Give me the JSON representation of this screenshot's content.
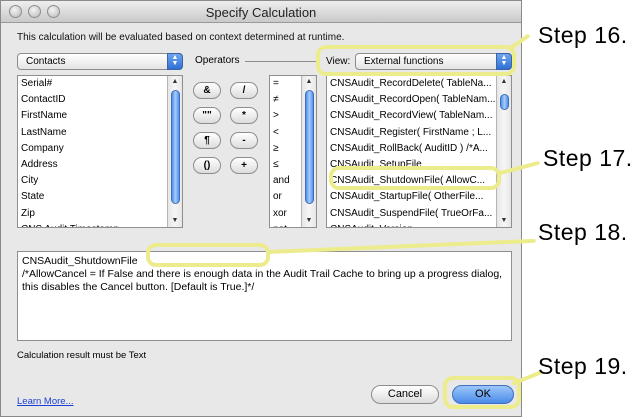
{
  "window": {
    "title": "Specify Calculation"
  },
  "description": "This calculation will be evaluated based on context determined at runtime.",
  "table_popup": {
    "selected": "Contacts"
  },
  "fields": [
    "Serial#",
    "ContactID",
    "FirstName",
    "LastName",
    "Company",
    "Address",
    "City",
    "State",
    "Zip",
    "CNS Audit Timestamp"
  ],
  "operators": {
    "label": "Operators",
    "buttons": [
      "&",
      "/",
      "\"\"",
      "*",
      "¶",
      "-",
      "()",
      "+"
    ],
    "list": [
      "=",
      "≠",
      ">",
      "<",
      "≥",
      "≤",
      "and",
      "or",
      "xor",
      "not"
    ]
  },
  "view": {
    "label": "View:",
    "selected": "External functions"
  },
  "functions": [
    "CNSAudit_RecordDelete( TableNa...",
    "CNSAudit_RecordOpen( TableNam...",
    "CNSAudit_RecordView( TableNam...",
    "CNSAudit_Register( FirstName ; L...",
    "CNSAudit_RollBack( AuditID ) /*A...",
    "CNSAudit_SetupFile",
    "CNSAudit_ShutdownFile( AllowC...",
    "CNSAudit_StartupFile( OtherFile...",
    "CNSAudit_SuspendFile( TrueOrFa...",
    "CNSAudit_Version"
  ],
  "calculation": {
    "line1": "CNSAudit_ShutdownFile",
    "line2": "/*AllowCancel = If False and there is enough data in the Audit Trail Cache to bring up a progress dialog, this disables the Cancel button. [Default is True.]*/"
  },
  "result_label": "Calculation result must be Text",
  "learn_more": "Learn More...",
  "buttons": {
    "cancel": "Cancel",
    "ok": "OK"
  },
  "steps": {
    "s16": "Step 16.",
    "s17": "Step 17.",
    "s18": "Step 18.",
    "s19": "Step 19."
  },
  "colors": {
    "highlight": "#ecec8c",
    "accent_blue": "#4a8be8",
    "link": "#1a3fd6"
  }
}
